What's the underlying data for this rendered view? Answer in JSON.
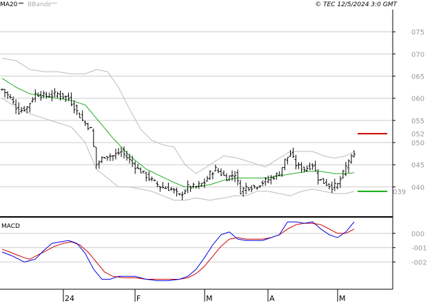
{
  "header": {
    "legend_ma": "MA20",
    "legend_bb": "BBands",
    "copyright": "© TEC 12/5/2024 3:0 GMT"
  },
  "colors": {
    "ma": "#22aa22",
    "bands": "#bbbbbb",
    "price": "#000000",
    "resistance": "#cc0000",
    "support": "#11aa11",
    "macd": "#0000dd",
    "signal": "#cc0000",
    "grid": "#cccccc"
  },
  "levels": {
    "resistance_label": "052",
    "support_label": "039",
    "resistance_value": 0.52,
    "support_value": 0.39
  },
  "chart_data": [
    {
      "type": "line",
      "name": "price",
      "y_tick_labels": [
        "075",
        "070",
        "065",
        "060",
        "055",
        "050",
        "045",
        "040"
      ],
      "y_tick_values": [
        0.75,
        0.7,
        0.65,
        0.6,
        0.55,
        0.5,
        0.45,
        0.4
      ],
      "ylim": [
        0.34,
        0.8
      ],
      "x_month_labels": [
        "24",
        "F",
        "M",
        "A",
        "M"
      ],
      "x_month_index": [
        22,
        48,
        73,
        96,
        121
      ],
      "bars": 128,
      "close_anchors": [
        [
          0,
          0.62
        ],
        [
          3,
          0.6
        ],
        [
          6,
          0.57
        ],
        [
          9,
          0.58
        ],
        [
          12,
          0.61
        ],
        [
          16,
          0.605
        ],
        [
          20,
          0.61
        ],
        [
          24,
          0.6
        ],
        [
          26,
          0.58
        ],
        [
          29,
          0.55
        ],
        [
          32,
          0.53
        ],
        [
          34,
          0.45
        ],
        [
          37,
          0.47
        ],
        [
          40,
          0.47
        ],
        [
          43,
          0.48
        ],
        [
          46,
          0.46
        ],
        [
          49,
          0.44
        ],
        [
          53,
          0.42
        ],
        [
          57,
          0.4
        ],
        [
          61,
          0.395
        ],
        [
          64,
          0.38
        ],
        [
          67,
          0.4
        ],
        [
          70,
          0.4
        ],
        [
          73,
          0.41
        ],
        [
          75,
          0.43
        ],
        [
          77,
          0.44
        ],
        [
          79,
          0.43
        ],
        [
          81,
          0.42
        ],
        [
          84,
          0.43
        ],
        [
          86,
          0.39
        ],
        [
          88,
          0.4
        ],
        [
          91,
          0.4
        ],
        [
          94,
          0.41
        ],
        [
          97,
          0.42
        ],
        [
          100,
          0.43
        ],
        [
          102,
          0.46
        ],
        [
          104,
          0.475
        ],
        [
          106,
          0.45
        ],
        [
          109,
          0.44
        ],
        [
          112,
          0.45
        ],
        [
          114,
          0.42
        ],
        [
          116,
          0.41
        ],
        [
          119,
          0.4
        ],
        [
          121,
          0.405
        ],
        [
          123,
          0.43
        ],
        [
          125,
          0.46
        ],
        [
          127,
          0.47
        ]
      ],
      "ma20_anchors": [
        [
          0,
          0.645
        ],
        [
          5,
          0.625
        ],
        [
          10,
          0.61
        ],
        [
          15,
          0.605
        ],
        [
          20,
          0.6
        ],
        [
          25,
          0.595
        ],
        [
          30,
          0.585
        ],
        [
          34,
          0.555
        ],
        [
          40,
          0.51
        ],
        [
          46,
          0.47
        ],
        [
          52,
          0.44
        ],
        [
          57,
          0.425
        ],
        [
          62,
          0.41
        ],
        [
          66,
          0.4
        ],
        [
          70,
          0.4
        ],
        [
          75,
          0.405
        ],
        [
          80,
          0.415
        ],
        [
          85,
          0.42
        ],
        [
          90,
          0.42
        ],
        [
          95,
          0.42
        ],
        [
          100,
          0.425
        ],
        [
          105,
          0.43
        ],
        [
          110,
          0.435
        ],
        [
          115,
          0.435
        ],
        [
          120,
          0.43
        ],
        [
          124,
          0.43
        ],
        [
          127,
          0.432
        ]
      ],
      "band_upper_anchors": [
        [
          0,
          0.69
        ],
        [
          5,
          0.685
        ],
        [
          10,
          0.665
        ],
        [
          15,
          0.66
        ],
        [
          20,
          0.66
        ],
        [
          25,
          0.655
        ],
        [
          30,
          0.655
        ],
        [
          34,
          0.665
        ],
        [
          38,
          0.66
        ],
        [
          42,
          0.625
        ],
        [
          46,
          0.575
        ],
        [
          50,
          0.53
        ],
        [
          54,
          0.505
        ],
        [
          58,
          0.495
        ],
        [
          62,
          0.49
        ],
        [
          66,
          0.45
        ],
        [
          70,
          0.43
        ],
        [
          75,
          0.45
        ],
        [
          80,
          0.47
        ],
        [
          85,
          0.465
        ],
        [
          90,
          0.455
        ],
        [
          95,
          0.445
        ],
        [
          100,
          0.465
        ],
        [
          104,
          0.48
        ],
        [
          108,
          0.48
        ],
        [
          112,
          0.48
        ],
        [
          116,
          0.47
        ],
        [
          120,
          0.465
        ],
        [
          124,
          0.47
        ],
        [
          127,
          0.48
        ]
      ],
      "band_lower_anchors": [
        [
          0,
          0.6
        ],
        [
          5,
          0.58
        ],
        [
          10,
          0.565
        ],
        [
          15,
          0.555
        ],
        [
          20,
          0.545
        ],
        [
          25,
          0.535
        ],
        [
          30,
          0.5
        ],
        [
          34,
          0.44
        ],
        [
          38,
          0.42
        ],
        [
          42,
          0.4
        ],
        [
          46,
          0.4
        ],
        [
          50,
          0.395
        ],
        [
          54,
          0.39
        ],
        [
          58,
          0.38
        ],
        [
          62,
          0.37
        ],
        [
          66,
          0.37
        ],
        [
          70,
          0.375
        ],
        [
          75,
          0.37
        ],
        [
          80,
          0.375
        ],
        [
          84,
          0.38
        ],
        [
          88,
          0.38
        ],
        [
          92,
          0.39
        ],
        [
          96,
          0.39
        ],
        [
          100,
          0.385
        ],
        [
          104,
          0.38
        ],
        [
          108,
          0.39
        ],
        [
          112,
          0.395
        ],
        [
          116,
          0.39
        ],
        [
          120,
          0.385
        ],
        [
          124,
          0.385
        ],
        [
          127,
          0.39
        ]
      ]
    },
    {
      "type": "line",
      "name": "MACD",
      "title": "MACD",
      "y_tick_labels": [
        "000",
        "-001",
        "-002"
      ],
      "y_tick_values": [
        0.0,
        -0.01,
        -0.02
      ],
      "ylim": [
        -0.038,
        0.01
      ],
      "series": [
        {
          "name": "macd",
          "anchors": [
            [
              0,
              -0.013
            ],
            [
              4,
              -0.016
            ],
            [
              8,
              -0.02
            ],
            [
              12,
              -0.018
            ],
            [
              15,
              -0.012
            ],
            [
              18,
              -0.007
            ],
            [
              21,
              -0.006
            ],
            [
              24,
              -0.005
            ],
            [
              27,
              -0.007
            ],
            [
              30,
              -0.014
            ],
            [
              33,
              -0.025
            ],
            [
              36,
              -0.032
            ],
            [
              39,
              -0.032
            ],
            [
              42,
              -0.03
            ],
            [
              45,
              -0.03
            ],
            [
              48,
              -0.03
            ],
            [
              52,
              -0.032
            ],
            [
              56,
              -0.033
            ],
            [
              60,
              -0.033
            ],
            [
              64,
              -0.032
            ],
            [
              67,
              -0.03
            ],
            [
              70,
              -0.025
            ],
            [
              73,
              -0.017
            ],
            [
              76,
              -0.008
            ],
            [
              79,
              -0.001
            ],
            [
              82,
              0.001
            ],
            [
              85,
              -0.004
            ],
            [
              88,
              -0.005
            ],
            [
              91,
              -0.005
            ],
            [
              94,
              -0.005
            ],
            [
              97,
              -0.003
            ],
            [
              100,
              -0.001
            ],
            [
              103,
              0.008
            ],
            [
              106,
              0.008
            ],
            [
              109,
              0.007
            ],
            [
              112,
              0.008
            ],
            [
              115,
              0.003
            ],
            [
              118,
              -0.001
            ],
            [
              121,
              -0.003
            ],
            [
              124,
              0.001
            ],
            [
              127,
              0.008
            ]
          ]
        },
        {
          "name": "signal",
          "anchors": [
            [
              0,
              -0.011
            ],
            [
              4,
              -0.014
            ],
            [
              8,
              -0.017
            ],
            [
              10,
              -0.018
            ],
            [
              13,
              -0.015
            ],
            [
              16,
              -0.012
            ],
            [
              19,
              -0.009
            ],
            [
              22,
              -0.007
            ],
            [
              25,
              -0.006
            ],
            [
              28,
              -0.008
            ],
            [
              31,
              -0.013
            ],
            [
              34,
              -0.02
            ],
            [
              37,
              -0.027
            ],
            [
              40,
              -0.03
            ],
            [
              44,
              -0.031
            ],
            [
              48,
              -0.031
            ],
            [
              52,
              -0.032
            ],
            [
              56,
              -0.032
            ],
            [
              60,
              -0.032
            ],
            [
              64,
              -0.032
            ],
            [
              67,
              -0.031
            ],
            [
              70,
              -0.028
            ],
            [
              73,
              -0.023
            ],
            [
              76,
              -0.016
            ],
            [
              79,
              -0.009
            ],
            [
              82,
              -0.004
            ],
            [
              85,
              -0.003
            ],
            [
              88,
              -0.004
            ],
            [
              91,
              -0.004
            ],
            [
              94,
              -0.004
            ],
            [
              97,
              -0.003
            ],
            [
              100,
              -0.001
            ],
            [
              103,
              0.003
            ],
            [
              106,
              0.006
            ],
            [
              109,
              0.007
            ],
            [
              112,
              0.007
            ],
            [
              115,
              0.006
            ],
            [
              118,
              0.003
            ],
            [
              121,
              0.0
            ],
            [
              124,
              0.0
            ],
            [
              127,
              0.003
            ]
          ]
        }
      ]
    }
  ]
}
